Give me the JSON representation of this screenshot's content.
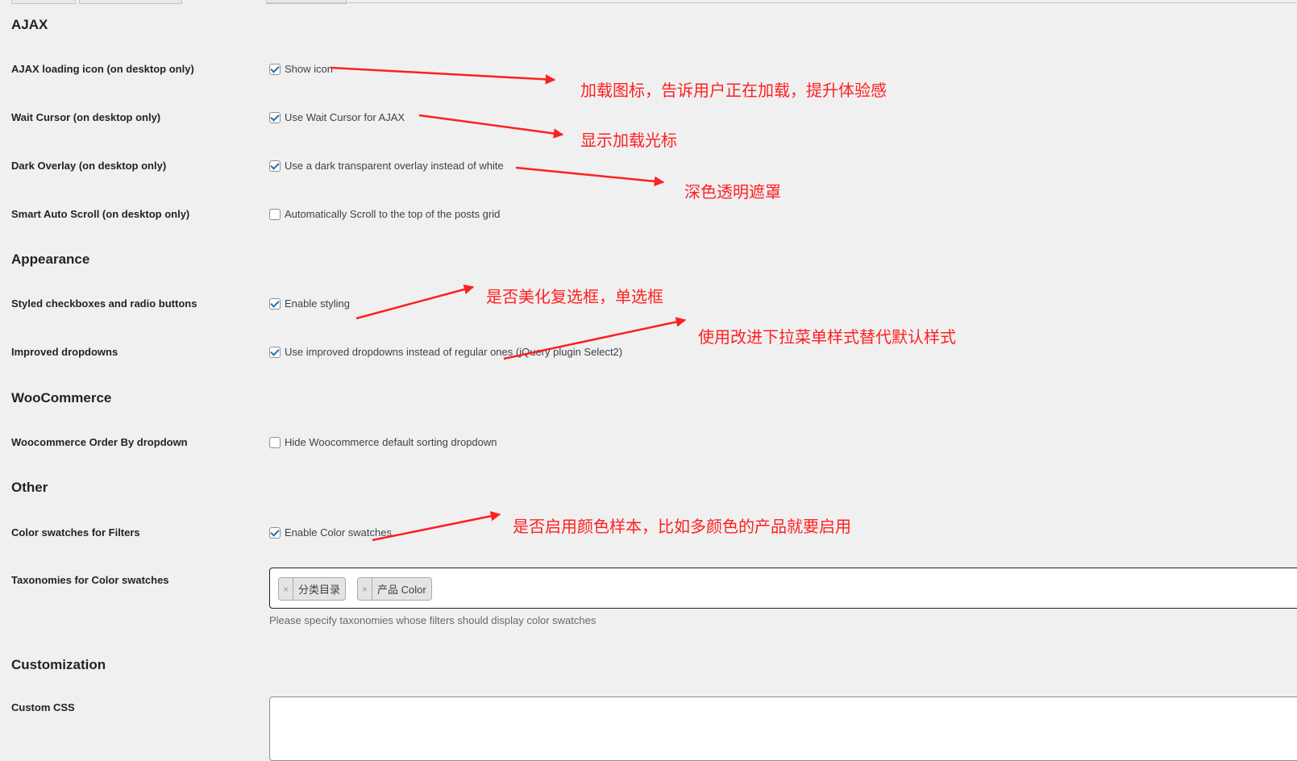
{
  "colors": {
    "background": "#f0f0f1",
    "text": "#1d2327",
    "checkbox_accent": "#2271b1",
    "annotation": "#ff1f1f"
  },
  "sections": {
    "ajax": {
      "title": "AJAX",
      "rows": [
        {
          "label": "AJAX loading icon (on desktop only)",
          "option": "Show icon",
          "checked": true
        },
        {
          "label": "Wait Cursor (on desktop only)",
          "option": "Use Wait Cursor for AJAX",
          "checked": true
        },
        {
          "label": "Dark Overlay (on desktop only)",
          "option": "Use a dark transparent overlay instead of white",
          "checked": true
        },
        {
          "label": "Smart Auto Scroll (on desktop only)",
          "option": "Automatically Scroll to the top of the posts grid",
          "checked": false
        }
      ]
    },
    "appearance": {
      "title": "Appearance",
      "rows": [
        {
          "label": "Styled checkboxes and radio buttons",
          "option": "Enable styling",
          "checked": true
        },
        {
          "label": "Improved dropdowns",
          "option": "Use improved dropdowns instead of regular ones (jQuery plugin Select2)",
          "checked": true
        }
      ]
    },
    "woocommerce": {
      "title": "WooCommerce",
      "rows": [
        {
          "label": "Woocommerce Order By dropdown",
          "option": "Hide Woocommerce default sorting dropdown",
          "checked": false
        }
      ]
    },
    "other": {
      "title": "Other",
      "rows": [
        {
          "label": "Color swatches for Filters",
          "option": "Enable Color swatches",
          "checked": true
        }
      ],
      "taxonomies": {
        "label": "Taxonomies for Color swatches",
        "tokens": [
          {
            "remove": "×",
            "text": "分类目录"
          },
          {
            "remove": "×",
            "text": "产品 Color"
          }
        ],
        "help": "Please specify taxonomies whose filters should display color swatches"
      }
    },
    "customization": {
      "title": "Customization",
      "custom_css_label": "Custom CSS"
    }
  },
  "annotations": [
    "加载图标，告诉用户正在加载，提升体验感",
    "显示加载光标",
    "深色透明遮罩",
    "是否美化复选框，单选框",
    "使用改进下拉菜单样式替代默认样式",
    "是否启用颜色样本，比如多颜色的产品就要启用"
  ]
}
